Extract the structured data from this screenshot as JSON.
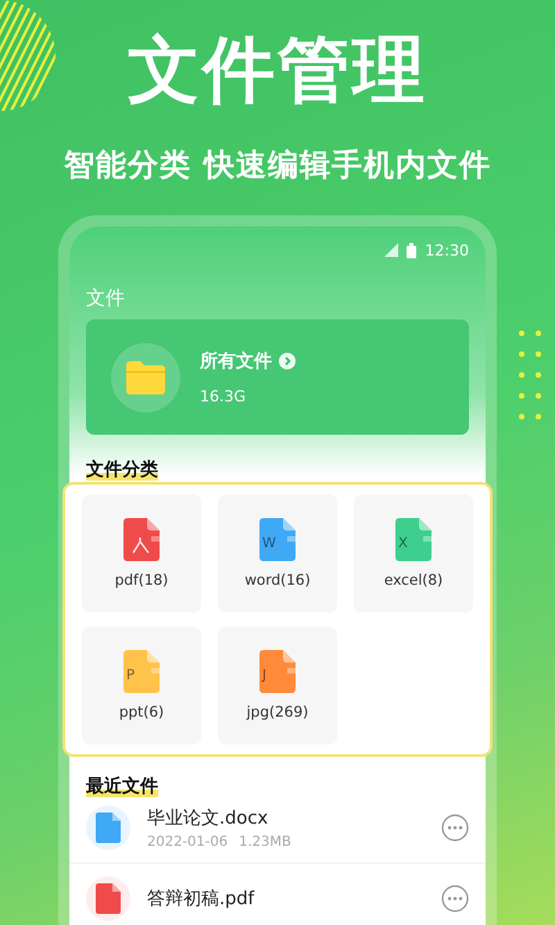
{
  "headline": "文件管理",
  "tagline": "智能分类 快速编辑手机内文件",
  "status_bar": {
    "time": "12:30"
  },
  "screen_title": "文件",
  "all_files": {
    "label": "所有文件",
    "size": "16.3G"
  },
  "categories_title": "文件分类",
  "categories": [
    {
      "label": "pdf(18)",
      "kind": "pdf",
      "color": "#ef4b4b"
    },
    {
      "label": "word(16)",
      "kind": "word",
      "color": "#3fa9f5",
      "letter": "W"
    },
    {
      "label": "excel(8)",
      "kind": "excel",
      "color": "#3ccf8e",
      "letter": "X"
    },
    {
      "label": "ppt(6)",
      "kind": "ppt",
      "color": "#ffc24a",
      "letter": "P"
    },
    {
      "label": "jpg(269)",
      "kind": "jpg",
      "color": "#ff8a3a",
      "letter": "J"
    }
  ],
  "recent_title": "最近文件",
  "recent": [
    {
      "name": "毕业论文.docx",
      "kind": "word",
      "date": "2022-01-06",
      "size": "1.23MB"
    },
    {
      "name": "答辩初稿.pdf",
      "kind": "pdf"
    }
  ]
}
